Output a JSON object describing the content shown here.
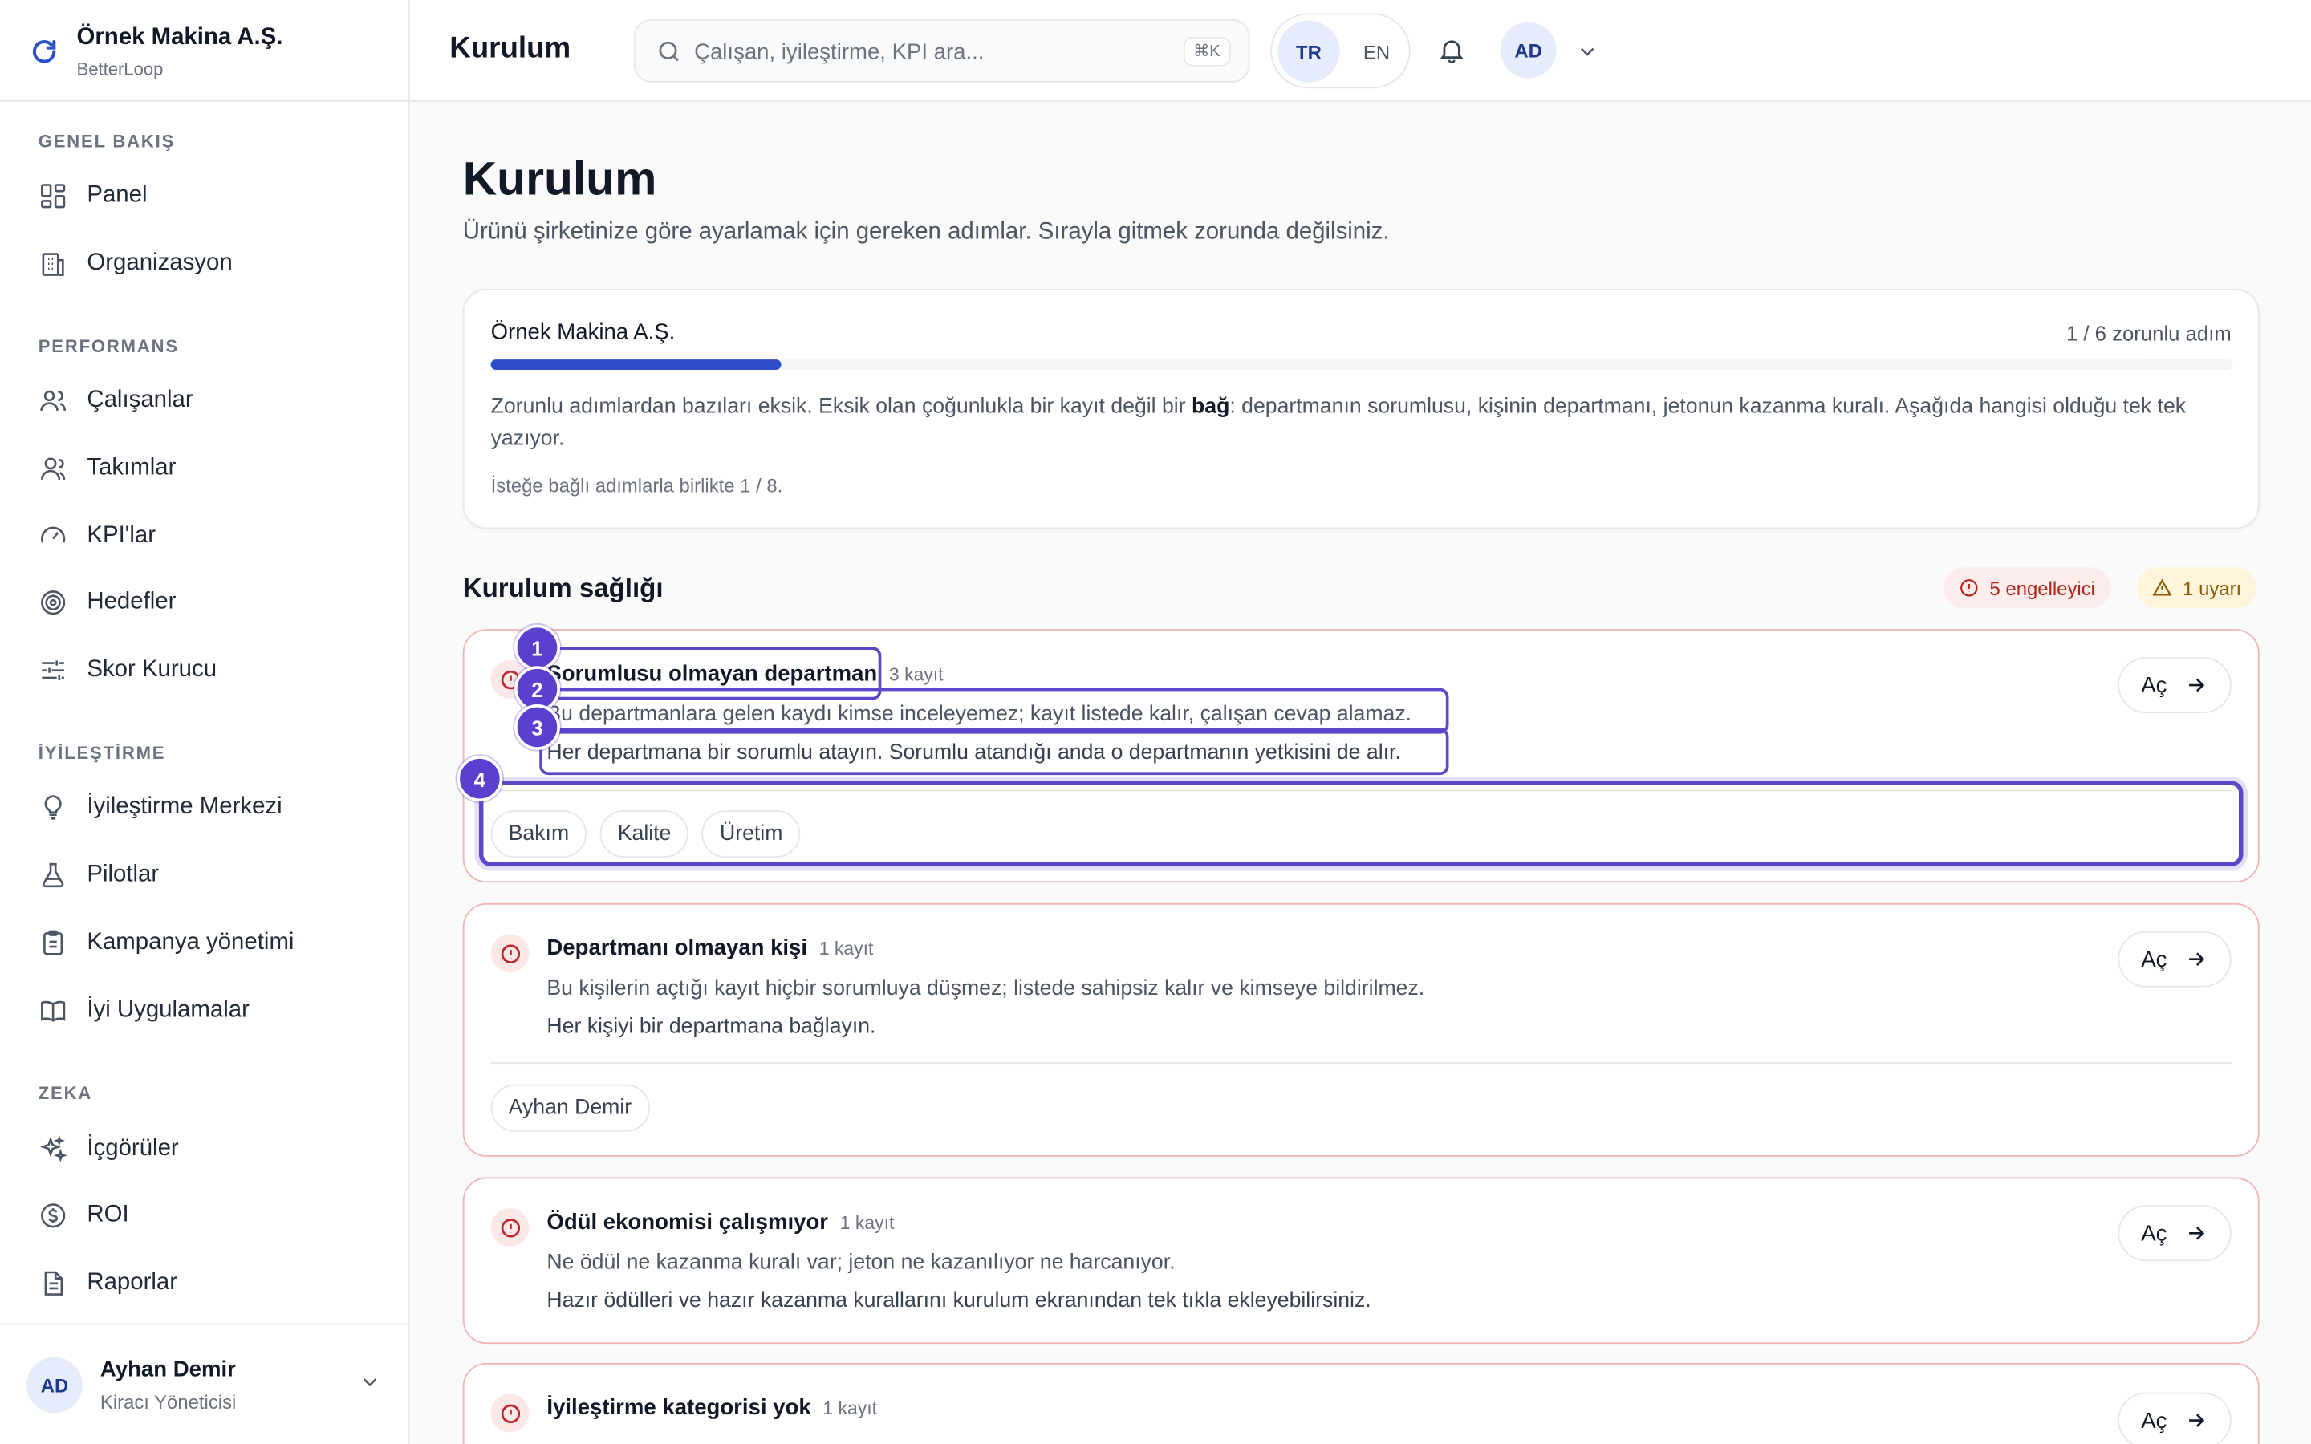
{
  "brand": {
    "name": "Örnek Makina A.Ş.",
    "sub": "BetterLoop"
  },
  "sidebar": {
    "sections": [
      {
        "label": "GENEL BAKIŞ"
      },
      {
        "label": "PERFORMANS"
      },
      {
        "label": "İYİLEŞTİRME"
      },
      {
        "label": "ZEKA"
      }
    ],
    "items": [
      {
        "label": "Panel",
        "icon": "dashboard-icon"
      },
      {
        "label": "Organizasyon",
        "icon": "building-icon"
      },
      {
        "label": "Çalışanlar",
        "icon": "users-icon"
      },
      {
        "label": "Takımlar",
        "icon": "team-icon"
      },
      {
        "label": "KPI'lar",
        "icon": "gauge-icon"
      },
      {
        "label": "Hedefler",
        "icon": "target-icon"
      },
      {
        "label": "Skor Kurucu",
        "icon": "sliders-icon"
      },
      {
        "label": "İyileştirme Merkezi",
        "icon": "lightbulb-icon"
      },
      {
        "label": "Pilotlar",
        "icon": "flask-icon"
      },
      {
        "label": "Kampanya yönetimi",
        "icon": "clipboard-icon"
      },
      {
        "label": "İyi Uygulamalar",
        "icon": "book-icon"
      },
      {
        "label": "İçgörüler",
        "icon": "sparkles-icon"
      },
      {
        "label": "ROI",
        "icon": "dollar-icon"
      },
      {
        "label": "Raporlar",
        "icon": "file-icon"
      }
    ],
    "user": {
      "initials": "AD",
      "name": "Ayhan Demir",
      "role": "Kiracı Yöneticisi"
    }
  },
  "topbar": {
    "title": "Kurulum",
    "search_placeholder": "Çalışan, iyileştirme, KPI ara...",
    "shortcut": "⌘K",
    "lang_active": "TR",
    "lang_other": "EN",
    "avatar": "AD"
  },
  "page": {
    "title": "Kurulum",
    "subtitle": "Ürünü şirketinize göre ayarlamak için gereken adımlar. Sırayla gitmek zorunda değilsiniz."
  },
  "progress": {
    "company": "Örnek Makina A.Ş.",
    "step_text": "1 / 6 zorunlu adım",
    "fraction": 0.1667,
    "desc_before": "Zorunlu adımlardan bazıları eksik. Eksik olan çoğunlukla bir kayıt değil bir ",
    "desc_bold": "bağ",
    "desc_after": ": departmanın sorumlusu, kişinin departmanı, jetonun kazanma kuralı. Aşağıda hangisi olduğu tek tek yazıyor.",
    "optional": "İsteğe bağlı adımlarla birlikte 1 / 8."
  },
  "health": {
    "title": "Kurulum sağlığı",
    "blockers": "5 engelleyici",
    "warnings": "1 uyarı",
    "issues": [
      {
        "title": "Sorumlusu olmayan departman",
        "count": "3 kayıt",
        "desc": "Bu departmanlara gelen kaydı kimse inceleyemez; kayıt listede kalır, çalışan cevap alamaz.",
        "fix": "Her departmana bir sorumlu atayın. Sorumlu atandığı anda o departmanın yetkisini de alır.",
        "chips": [
          "Bakım",
          "Kalite",
          "Üretim"
        ]
      },
      {
        "title": "Departmanı olmayan kişi",
        "count": "1 kayıt",
        "desc": "Bu kişilerin açtığı kayıt hiçbir sorumluya düşmez; listede sahipsiz kalır ve kimseye bildirilmez.",
        "fix": "Her kişiyi bir departmana bağlayın.",
        "chips": [
          "Ayhan Demir"
        ]
      },
      {
        "title": "Ödül ekonomisi çalışmıyor",
        "count": "1 kayıt",
        "desc": "Ne ödül ne kazanma kuralı var; jeton ne kazanılıyor ne harcanıyor.",
        "fix": "Hazır ödülleri ve hazır kazanma kurallarını kurulum ekranından tek tıkla ekleyebilirsiniz."
      },
      {
        "title": "İyileştirme kategorisi yok",
        "count": "1 kayıt"
      }
    ],
    "open_label": "Aç"
  },
  "markers": [
    "1",
    "2",
    "3",
    "4"
  ],
  "colors": {
    "accent": "#2c4fc9",
    "error": "#c0262d",
    "annotation": "#5b3fcf"
  }
}
